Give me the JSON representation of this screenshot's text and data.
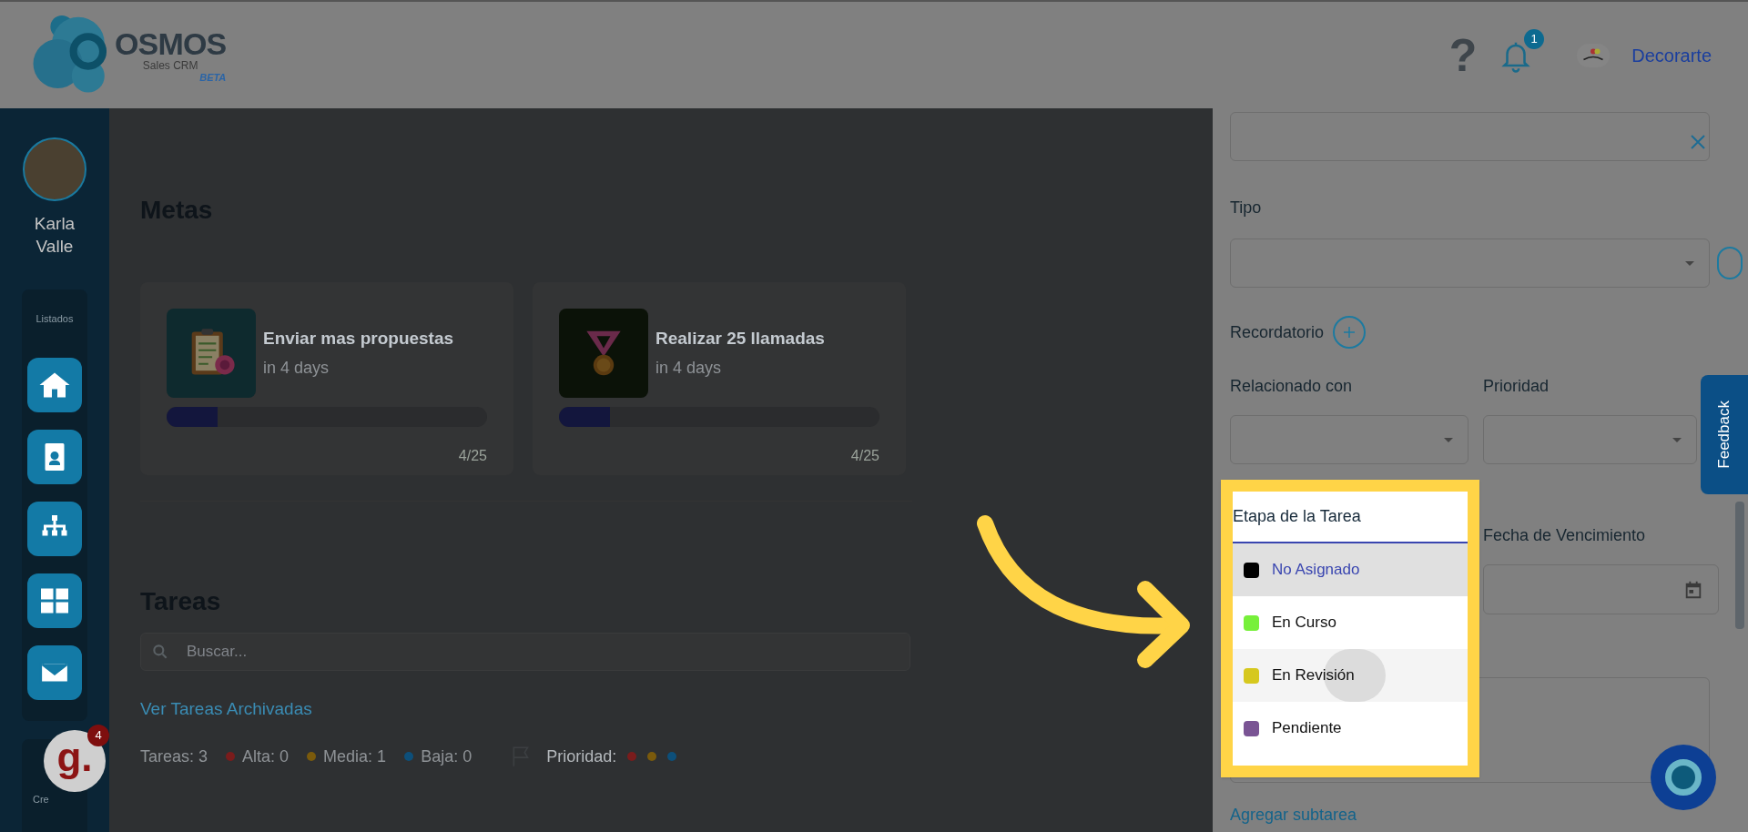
{
  "header": {
    "logo": {
      "name": "OSMOS",
      "subtitle": "Sales CRM",
      "tag": "BETA"
    },
    "help": "?",
    "notifications": "1",
    "company": "Decorarte"
  },
  "sidebar": {
    "user": "Karla Valle",
    "section": "Listados",
    "second_section": "Cre",
    "widget": {
      "logo": "g.",
      "count": "4"
    }
  },
  "metas": {
    "title": "Metas",
    "goals": [
      {
        "title": "Enviar mas propuestas",
        "due": "in 4 days",
        "level": 0.16,
        "progress": "4/25"
      },
      {
        "title": "Realizar 25 llamadas",
        "due": "in 4 days",
        "level": 0.16,
        "progress": "4/25"
      }
    ]
  },
  "tareas": {
    "title": "Tareas",
    "search": {
      "placeholder": "Buscar..."
    },
    "archived_link": "Ver Tareas Archivadas",
    "summary": "Tareas: 3",
    "counts": [
      {
        "label": "Alta: 0",
        "color": "#7a1c1c"
      },
      {
        "label": "Media: 1",
        "color": "#7a5a0c"
      },
      {
        "label": "Baja: 0",
        "color": "#0d4f7a"
      }
    ],
    "priority_label": "Prioridad:",
    "priority_colors": [
      {
        "color": "#7a1c1c"
      },
      {
        "color": "#7a5a0c"
      },
      {
        "color": "#0d4f7a"
      }
    ]
  },
  "form": {
    "tipo_label": "Tipo",
    "reminder_label": "Recordatorio",
    "related_label": "Relacionado con",
    "priority_label": "Prioridad",
    "due_label": "Fecha de Vencimiento",
    "subtask_link": "Agregar subtarea",
    "stage_dropdown": {
      "label": "Etapa de la Tarea",
      "options": [
        {
          "label": "No Asignado",
          "color": "#000000",
          "selected": true,
          "hovered": false
        },
        {
          "label": "En Curso",
          "color": "#77f03a",
          "selected": false,
          "hovered": false
        },
        {
          "label": "En Revisión",
          "color": "#d6c81e",
          "selected": false,
          "hovered": true
        },
        {
          "label": "Pendiente",
          "color": "#7a5494",
          "selected": false,
          "hovered": false
        }
      ]
    }
  },
  "feedback": "Feedback"
}
